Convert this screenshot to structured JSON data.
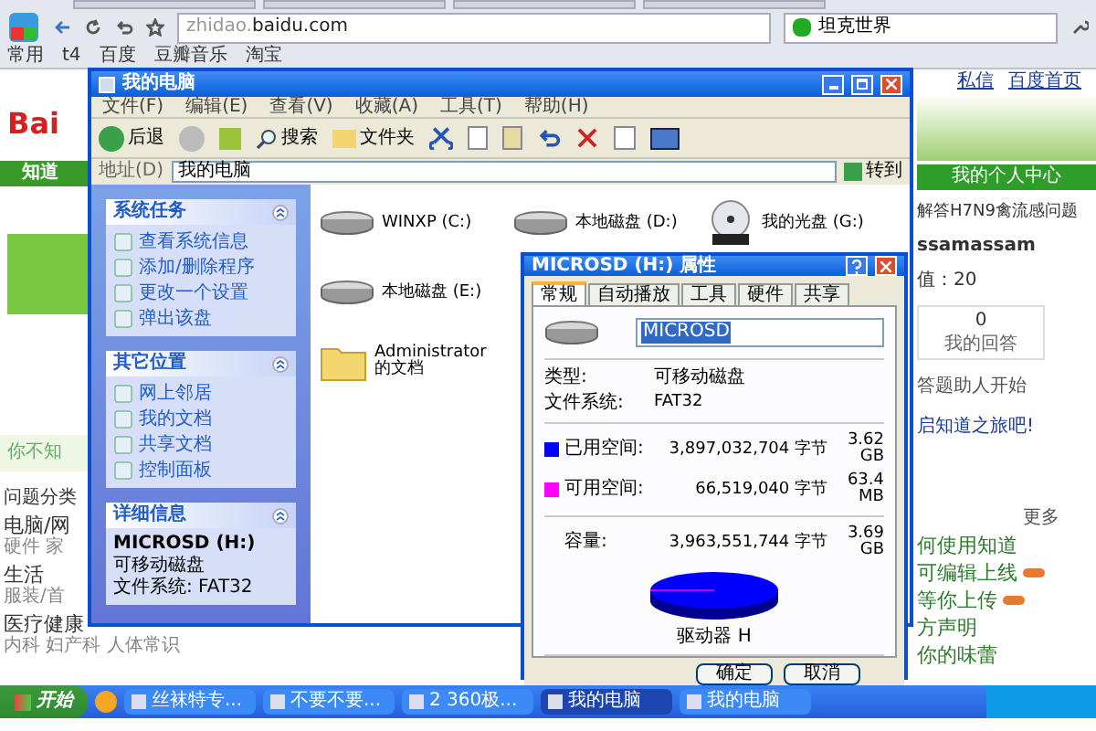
{
  "browser": {
    "address": {
      "subdomain": "zhidao.",
      "domain": "baidu.com"
    },
    "search": {
      "value": "坦克世界"
    },
    "bookmarks": [
      "常用",
      "t4",
      "百度",
      "豆瓣音乐",
      "淘宝"
    ]
  },
  "page_left": {
    "logo": "Bai",
    "nav": "知道",
    "promo": "你不知",
    "categories_title": "问题分类",
    "categories": [
      {
        "name": "电脑/网",
        "tags": "硬件 家"
      },
      {
        "name": "生活",
        "tags": "服装/首"
      },
      {
        "name": "医疗健康",
        "tags": "内科  妇产科  人体常识"
      }
    ]
  },
  "page_right": {
    "links": [
      "私信",
      "百度首页"
    ],
    "profile_button": "我的个人中心",
    "notice": "解答H7N9禽流感问题",
    "username": "ssamassam",
    "score": "值：20",
    "answers": {
      "count": "0",
      "label": "我的回答"
    },
    "tip": "答题助人开始",
    "tip2": "启知道之旅吧!",
    "more": "更多",
    "list": [
      {
        "text": "何使用知道",
        "new": false
      },
      {
        "text": "可编辑上线",
        "new": true
      },
      {
        "text": "等你上传",
        "new": true
      },
      {
        "text": "方声明",
        "new": false
      },
      {
        "text": "你的味蕾",
        "new": false
      }
    ]
  },
  "explorer": {
    "title": "我的电脑",
    "menu": [
      "文件(F)",
      "编辑(E)",
      "查看(V)",
      "收藏(A)",
      "工具(T)",
      "帮助(H)"
    ],
    "toolbar": {
      "back": "后退",
      "search": "搜索",
      "folders": "文件夹"
    },
    "address": {
      "label": "地址(D)",
      "value": "我的电脑",
      "go": "转到"
    },
    "panels": [
      {
        "title": "系统任务",
        "items": [
          "查看系统信息",
          "添加/删除程序",
          "更改一个设置",
          "弹出该盘"
        ]
      },
      {
        "title": "其它位置",
        "items": [
          "网上邻居",
          "我的文档",
          "共享文档",
          "控制面板"
        ]
      }
    ],
    "details": {
      "title": "详细信息",
      "name": "MICROSD (H:)",
      "type": "可移动磁盘",
      "fs": "文件系统: FAT32"
    },
    "items": [
      {
        "kind": "disk",
        "label": "WINXP (C:)"
      },
      {
        "kind": "disk",
        "label": "本地磁盘 (D:)"
      },
      {
        "kind": "cd",
        "label": "我的光盘 (G:)"
      },
      {
        "kind": "disk",
        "label": "本地磁盘 (E:)"
      },
      {
        "kind": "blank"
      },
      {
        "kind": "blank"
      },
      {
        "kind": "folder",
        "label": "Administrator 的文档"
      }
    ]
  },
  "dialog": {
    "title": "MICROSD (H:) 属性",
    "tabs": [
      {
        "label": "常规",
        "selected": true
      },
      {
        "label": "自动播放",
        "selected": false
      },
      {
        "label": "工具",
        "selected": false
      },
      {
        "label": "硬件",
        "selected": false
      },
      {
        "label": "共享",
        "selected": false
      }
    ],
    "name_value": "MICROSD",
    "type_label": "类型:",
    "type_value": "可移动磁盘",
    "fs_label": "文件系统:",
    "fs_value": "FAT32",
    "space": [
      {
        "label": "已用空间:",
        "bytes": "3,897,032,704 字节",
        "size": "3.62 GB",
        "color": "#0000ff"
      },
      {
        "label": "可用空间:",
        "bytes": "66,519,040 字节",
        "size": "63.4 MB",
        "color": "#ff00ff"
      }
    ],
    "capacity": {
      "label": "容量:",
      "bytes": "3,963,551,744 字节",
      "size": "3.69 GB"
    },
    "drive_label": "驱动器 H",
    "buttons": [
      "确定",
      "取消"
    ]
  },
  "taskbar": {
    "start": "开始",
    "items": [
      {
        "label": "丝袜特专...",
        "selected": false
      },
      {
        "label": "不要不要...",
        "selected": false
      },
      {
        "label": "2 360极...",
        "selected": false
      },
      {
        "label": "我的电脑",
        "selected": true
      },
      {
        "label": "我的电脑",
        "selected": false
      }
    ]
  }
}
